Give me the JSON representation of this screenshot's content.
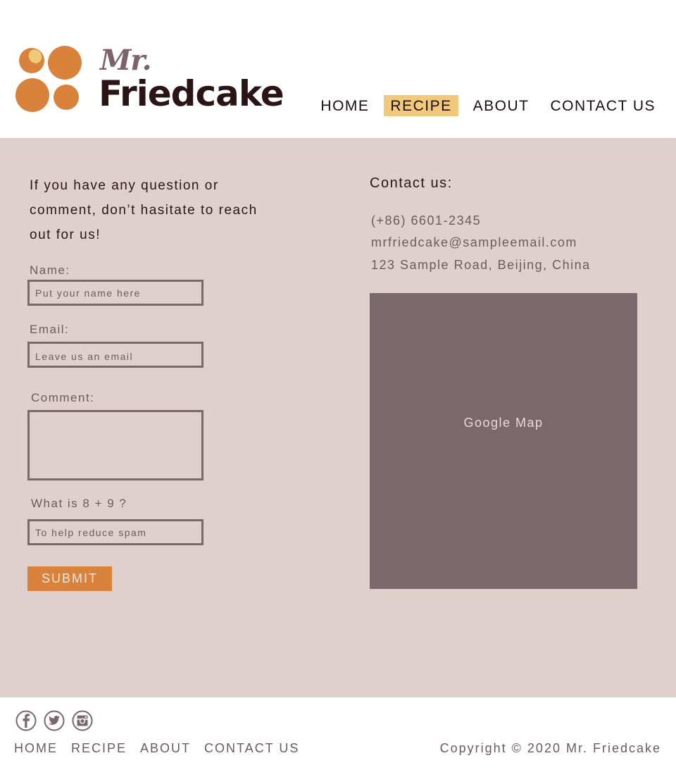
{
  "header": {
    "logo": {
      "mr": "Mr.",
      "name": "Friedcake"
    },
    "nav": [
      {
        "label": "HOME",
        "active": false
      },
      {
        "label": "RECIPE",
        "active": true
      },
      {
        "label": "ABOUT",
        "active": false
      },
      {
        "label": "CONTACT US",
        "active": false
      }
    ]
  },
  "form": {
    "intro": "If you have any question or comment, don’t hasitate to reach out for us!",
    "name_label": "Name:",
    "name_placeholder": "Put your name here",
    "email_label": "Email:",
    "email_placeholder": "Leave us an email",
    "comment_label": "Comment:",
    "captcha_label": "What is 8 + 9 ?",
    "captcha_placeholder": "To help reduce spam",
    "submit_label": "SUBMIT"
  },
  "contact": {
    "title": "Contact us:",
    "phone": "(+86) 6601-2345",
    "email": "mrfriedcake@sampleemail.com",
    "address": "123 Sample Road, Beijing, China",
    "map_label": "Google Map"
  },
  "footer": {
    "social": [
      "facebook-icon",
      "twitter-icon",
      "instagram-icon"
    ],
    "nav": [
      "HOME",
      "RECIPE",
      "ABOUT",
      "CONTACT US"
    ],
    "copyright": "Copyright © 2020 Mr. Friedcake"
  },
  "colors": {
    "brand_orange": "#d9823b",
    "nav_highlight": "#f2c87a",
    "main_bg": "#dfd0ce",
    "muted_mauve": "#7b676c",
    "dark_brown": "#2b1414"
  }
}
